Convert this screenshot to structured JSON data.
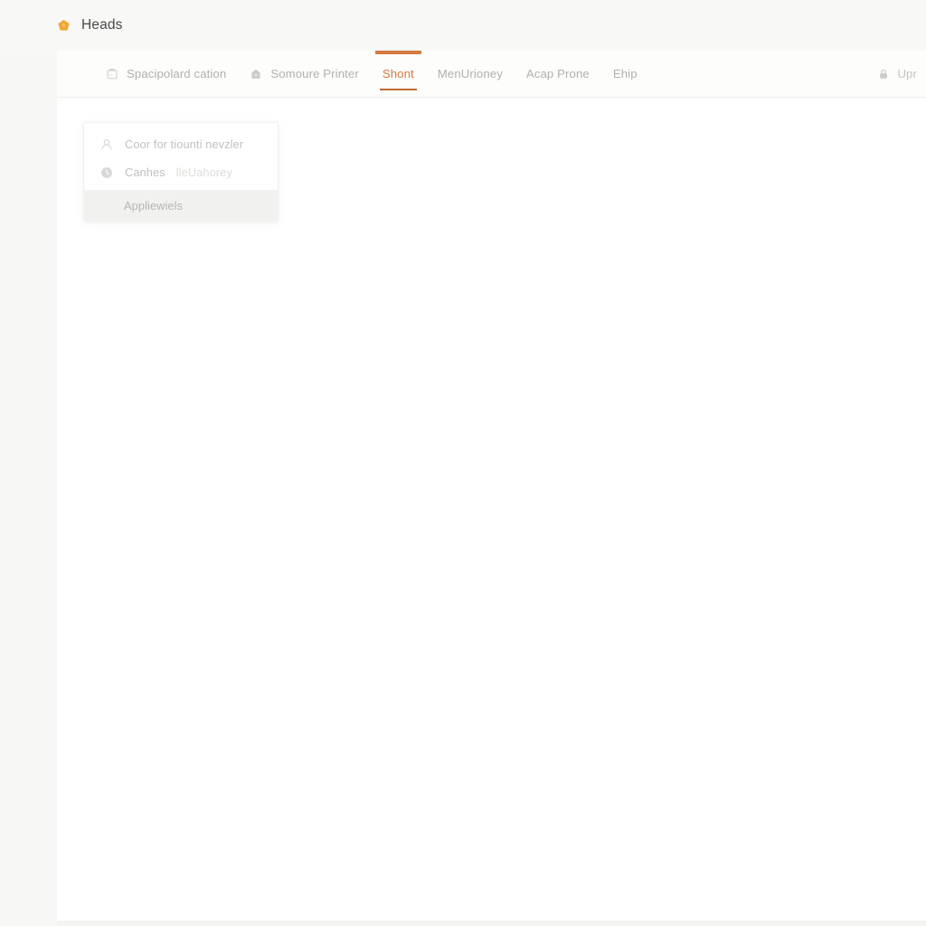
{
  "header": {
    "title": "Heads",
    "logo_icon": "pentagon-badge-icon",
    "logo_color": "#f0a732"
  },
  "theme": {
    "accent": "#d4793f",
    "accent_dark": "#c06a33",
    "page_background": "#f7f7f6",
    "panel_background": "#ffffff",
    "muted_text": "#b3b0ad",
    "highlight_row": "#f1f1f0"
  },
  "tabs": {
    "items": [
      {
        "label": "Spacipolard cation",
        "icon": "clipboard-icon",
        "active": false
      },
      {
        "label": "Somoure Printer",
        "icon": "lock-bag-icon",
        "active": false
      },
      {
        "label": "Shont",
        "icon": "",
        "active": true
      },
      {
        "label": "MenUrioney",
        "icon": "",
        "active": false
      },
      {
        "label": "Acap Prone",
        "icon": "",
        "active": false
      },
      {
        "label": "Ehip",
        "icon": "",
        "active": false
      }
    ],
    "right_item": {
      "label": "Upr",
      "icon": "lock-icon"
    }
  },
  "dropdown": {
    "items": [
      {
        "label": "Coor for tiounti nevzler",
        "icon": "user-icon",
        "highlighted": false,
        "secondary": ""
      },
      {
        "label": "Canhes",
        "secondary": "lleUahorey",
        "icon": "clock-circle-icon",
        "highlighted": false
      },
      {
        "label": "Appliewiels",
        "secondary": "",
        "icon": "",
        "highlighted": true
      }
    ]
  }
}
